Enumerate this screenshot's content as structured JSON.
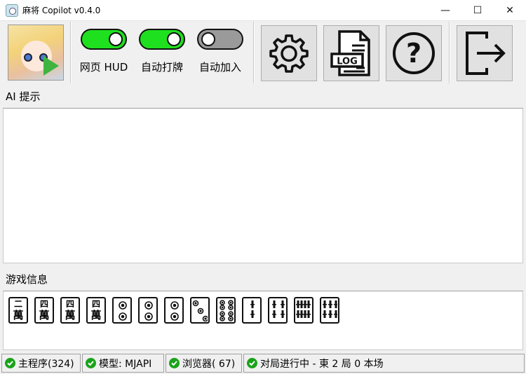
{
  "window": {
    "title": "麻将 Copilot v0.4.0",
    "minimize": "—",
    "maximize": "☐",
    "close": "✕"
  },
  "toolbar": {
    "toggles": [
      {
        "label": "网页 HUD",
        "state": "on"
      },
      {
        "label": "自动打牌",
        "state": "on"
      },
      {
        "label": "自动加入",
        "state": "off"
      }
    ],
    "buttons": [
      {
        "name": "settings",
        "icon": "gear-icon"
      },
      {
        "name": "log",
        "icon": "log-document-icon",
        "text": "LOG"
      },
      {
        "name": "help",
        "icon": "question-icon",
        "text": "?"
      },
      {
        "name": "exit",
        "icon": "exit-icon"
      }
    ]
  },
  "ai_section": {
    "label": "AI 提示",
    "content": ""
  },
  "game_section": {
    "label": "游戏信息",
    "tiles": [
      {
        "suit": "man",
        "num": "二",
        "man": "萬"
      },
      {
        "suit": "man",
        "num": "四",
        "man": "萬"
      },
      {
        "suit": "man",
        "num": "四",
        "man": "萬"
      },
      {
        "suit": "man",
        "num": "四",
        "man": "萬"
      },
      {
        "suit": "pin",
        "count": 2
      },
      {
        "suit": "pin",
        "count": 2
      },
      {
        "suit": "pin",
        "count": 2
      },
      {
        "suit": "pin",
        "count": 3
      },
      {
        "suit": "pin",
        "count": 8
      },
      {
        "suit": "sou",
        "count": 2
      },
      {
        "suit": "sou",
        "count": 4
      },
      {
        "suit": "sou",
        "count": 8
      },
      {
        "suit": "sou",
        "count": 6
      }
    ]
  },
  "status": [
    {
      "text": "主程序(324)"
    },
    {
      "text": "模型: MJAPI"
    },
    {
      "text": "浏览器( 67)"
    },
    {
      "text": "对局进行中 - 東 2 局 0 本场"
    }
  ],
  "colors": {
    "toggle_on": "#1fe01f",
    "toggle_off": "#9a9a9a",
    "status_ok": "#1aa31a"
  }
}
